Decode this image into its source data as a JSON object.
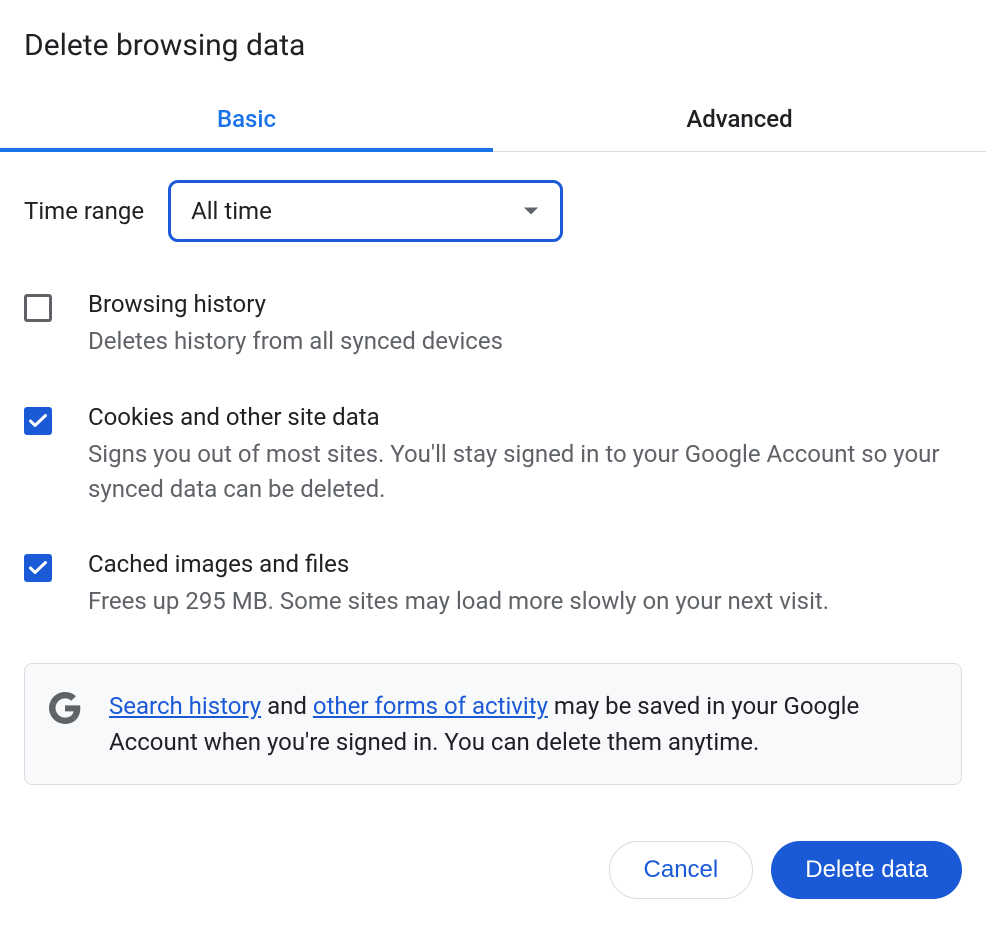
{
  "dialog": {
    "title": "Delete browsing data"
  },
  "tabs": {
    "basic": "Basic",
    "advanced": "Advanced"
  },
  "timeRange": {
    "label": "Time range",
    "value": "All time"
  },
  "options": {
    "browsingHistory": {
      "title": "Browsing history",
      "desc": "Deletes history from all synced devices",
      "checked": false
    },
    "cookies": {
      "title": "Cookies and other site data",
      "desc": "Signs you out of most sites. You'll stay signed in to your Google Account so your synced data can be deleted.",
      "checked": true
    },
    "cache": {
      "title": "Cached images and files",
      "desc": "Frees up 295 MB. Some sites may load more slowly on your next visit.",
      "checked": true
    }
  },
  "info": {
    "link1": "Search history",
    "mid1": " and ",
    "link2": "other forms of activity",
    "rest": " may be saved in your Google Account when you're signed in. You can delete them anytime."
  },
  "buttons": {
    "cancel": "Cancel",
    "delete": "Delete data"
  }
}
